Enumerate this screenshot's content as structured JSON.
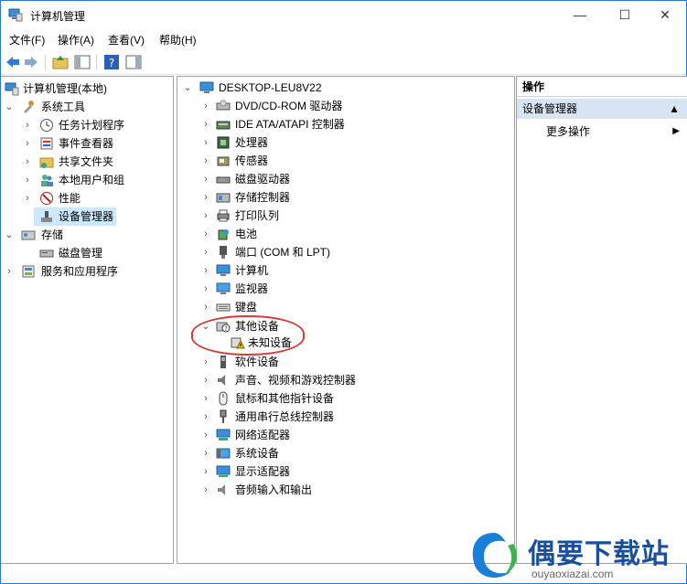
{
  "window": {
    "title": "计算机管理",
    "minimize": "—",
    "maximize": "☐",
    "close": "✕"
  },
  "menu": [
    "文件(F)",
    "操作(A)",
    "查看(V)",
    "帮助(H)"
  ],
  "left_tree": {
    "root": "计算机管理(本地)",
    "system_tools": "系统工具",
    "task_scheduler": "任务计划程序",
    "event_viewer": "事件查看器",
    "shared_folders": "共享文件夹",
    "local_users": "本地用户和组",
    "performance": "性能",
    "device_manager": "设备管理器",
    "storage": "存储",
    "disk_management": "磁盘管理",
    "services_apps": "服务和应用程序"
  },
  "device_tree": {
    "computer": "DESKTOP-LEU8V22",
    "items": [
      "DVD/CD-ROM 驱动器",
      "IDE ATA/ATAPI 控制器",
      "处理器",
      "传感器",
      "磁盘驱动器",
      "存储控制器",
      "打印队列",
      "电池",
      "端口 (COM 和 LPT)",
      "计算机",
      "监视器",
      "键盘",
      "其他设备",
      "未知设备",
      "软件设备",
      "声音、视频和游戏控制器",
      "鼠标和其他指针设备",
      "通用串行总线控制器",
      "网络适配器",
      "系统设备",
      "显示适配器",
      "音频输入和输出"
    ]
  },
  "actions": {
    "header": "操作",
    "section": "设备管理器",
    "more": "更多操作"
  },
  "watermark": {
    "name": "偶要下载站",
    "url": "ouyaoxiazai.com"
  },
  "colors": {
    "selection": "#cce8ff",
    "accent": "#2b79d0",
    "annotation": "#d83a3a",
    "brand": "#1a4f9c"
  }
}
